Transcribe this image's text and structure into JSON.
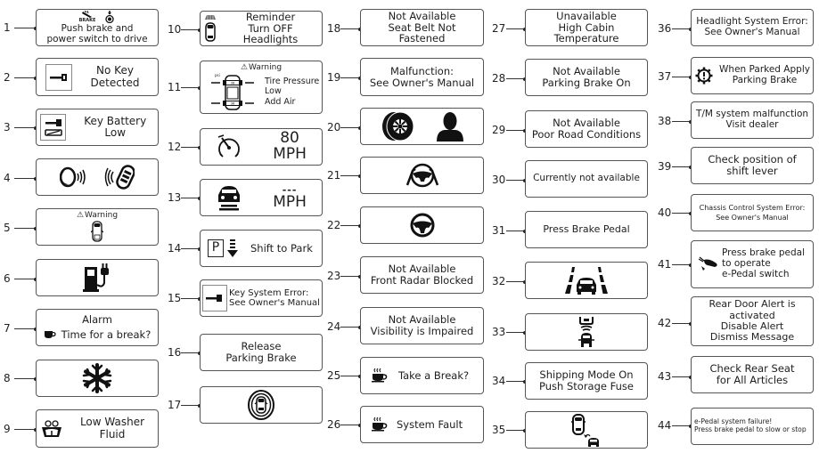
{
  "items": [
    {
      "n": "1",
      "lines": "Push brake and\npower switch to drive",
      "icons": [
        "brake-pedal-icon",
        "power-switch-icon"
      ],
      "icon_label": "BRAKE"
    },
    {
      "n": "2",
      "lines": "No Key\nDetected",
      "icons": [
        "key-icon"
      ]
    },
    {
      "n": "3",
      "lines": "Key Battery Low",
      "icons": [
        "key-battery-icon"
      ]
    },
    {
      "n": "4",
      "lines": "",
      "icons": [
        "push-button-signal-icon",
        "key-fob-signal-icon"
      ]
    },
    {
      "n": "5",
      "lines": "",
      "warning": "Warning",
      "icons": [
        "car-door-open-icon"
      ]
    },
    {
      "n": "6",
      "lines": "",
      "icons": [
        "fuel-pump-plug-icon"
      ]
    },
    {
      "n": "7",
      "title": "Alarm",
      "lines": "Time for a break?",
      "icons": [
        "coffee-cup-icon"
      ]
    },
    {
      "n": "8",
      "lines": "",
      "icons": [
        "snowflake-icon"
      ]
    },
    {
      "n": "9",
      "lines": "Low Washer Fluid",
      "icons": [
        "washer-fluid-icon"
      ]
    },
    {
      "n": "10",
      "lines": "Reminder\nTurn OFF Headlights",
      "icons": [
        "car-headlights-icon"
      ]
    },
    {
      "n": "11",
      "warning": "Warning",
      "lines": "Tire Pressure\nLow\nAdd Air",
      "icons": [
        "tire-pressure-car-icon"
      ],
      "psi_label": "psi",
      "tire_values": [
        "36",
        "36"
      ]
    },
    {
      "n": "12",
      "lines": "80\nMPH",
      "icons": [
        "speedometer-set-icon"
      ]
    },
    {
      "n": "13",
      "lines": "MPH",
      "placeholder": "---",
      "icons": [
        "car-distance-icon"
      ]
    },
    {
      "n": "14",
      "lines": "Shift to Park",
      "gear": "P",
      "icons": [
        "park-gear-icon",
        "shift-down-arrow-icon"
      ]
    },
    {
      "n": "15",
      "lines": "Key System Error:\nSee Owner's Manual",
      "icons": [
        "key-icon"
      ]
    },
    {
      "n": "16",
      "lines": "Release\nParking Brake",
      "icons": []
    },
    {
      "n": "17",
      "lines": "",
      "icons": [
        "car-in-circle-icon"
      ]
    },
    {
      "n": "18",
      "lines": "Not Available\nSeat Belt Not\nFastened",
      "icons": []
    },
    {
      "n": "19",
      "lines": "Malfunction:\nSee Owner's Manual",
      "icons": []
    },
    {
      "n": "20",
      "lines": "",
      "icons": [
        "tire-icon",
        "person-icon"
      ]
    },
    {
      "n": "21",
      "lines": "",
      "icons": [
        "hands-on-wheel-icon"
      ]
    },
    {
      "n": "22",
      "lines": "",
      "icons": [
        "steering-wheel-icon"
      ]
    },
    {
      "n": "23",
      "lines": "Not Available\nFront Radar Blocked",
      "icons": []
    },
    {
      "n": "24",
      "lines": "Not Available\nVisibility is Impaired",
      "icons": []
    },
    {
      "n": "25",
      "lines": "Take a Break?",
      "icons": [
        "hot-coffee-icon"
      ]
    },
    {
      "n": "26",
      "lines": "System Fault",
      "icons": [
        "hot-coffee-icon"
      ]
    },
    {
      "n": "27",
      "lines": "Unavailable\nHigh Cabin\nTemperature",
      "icons": []
    },
    {
      "n": "28",
      "lines": "Not Available\nParking Brake On",
      "icons": []
    },
    {
      "n": "29",
      "lines": "Not Available\nPoor Road Conditions",
      "icons": []
    },
    {
      "n": "30",
      "lines": "Currently not available",
      "icons": []
    },
    {
      "n": "31",
      "lines": "Press Brake Pedal",
      "icons": []
    },
    {
      "n": "32",
      "lines": "",
      "icons": [
        "lane-car-icon"
      ]
    },
    {
      "n": "33",
      "lines": "",
      "icons": [
        "rear-cross-traffic-icon"
      ]
    },
    {
      "n": "34",
      "lines": "Shipping Mode On\nPush Storage Fuse",
      "icons": []
    },
    {
      "n": "35",
      "lines": "",
      "icons": [
        "car-following-icon"
      ]
    },
    {
      "n": "36",
      "lines": "Headlight System Error:\nSee Owner's Manual",
      "icons": []
    },
    {
      "n": "37",
      "lines": "When Parked Apply\nParking Brake",
      "icons": [
        "gear-warning-icon"
      ]
    },
    {
      "n": "38",
      "lines": "T/M system malfunction\nVisit dealer",
      "icons": []
    },
    {
      "n": "39",
      "lines": "Check position of\nshift lever",
      "icons": []
    },
    {
      "n": "40",
      "lines": "Chassis Control System Error:\nSee Owner's Manual",
      "icons": []
    },
    {
      "n": "41",
      "lines": "Press brake pedal\nto operate\ne-Pedal switch",
      "icons": [
        "foot-pedal-icon"
      ]
    },
    {
      "n": "42",
      "lines": "Rear Door Alert is\nactivated\nDisable Alert\nDismiss Message",
      "icons": []
    },
    {
      "n": "43",
      "lines": "Check Rear Seat\nfor All Articles",
      "icons": []
    },
    {
      "n": "44",
      "lines": "e-Pedal system failure!\nPress brake pedal to slow or stop",
      "icons": []
    }
  ]
}
